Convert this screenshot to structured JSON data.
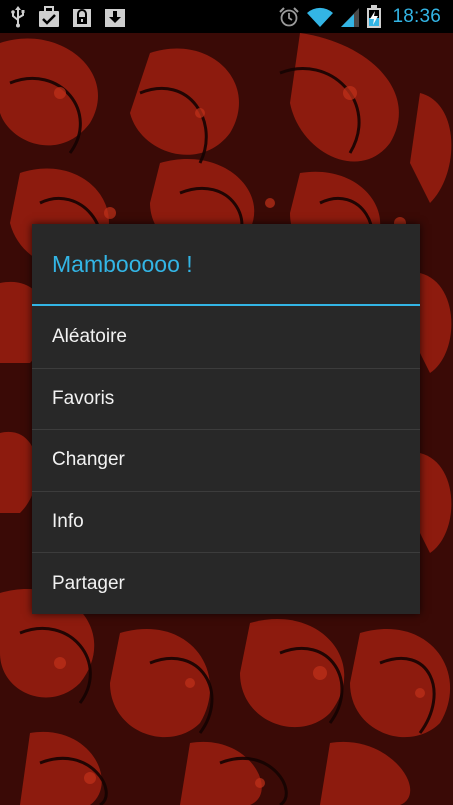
{
  "status_bar": {
    "time": "18:36",
    "left_icons": [
      "usb-icon",
      "checkbox-icon",
      "lock-icon",
      "download-icon"
    ],
    "right_icons": [
      "alarm-icon",
      "wifi-icon",
      "signal-icon",
      "battery-charging-icon"
    ],
    "accent_color": "#33b5e5"
  },
  "dialog": {
    "title": "Mambooooo !",
    "items": [
      {
        "label": "Aléatoire"
      },
      {
        "label": "Favoris"
      },
      {
        "label": "Changer"
      },
      {
        "label": "Info"
      },
      {
        "label": "Partager"
      }
    ]
  },
  "colors": {
    "accent": "#33b5e5",
    "dialog_bg": "#282828",
    "wallpaper_base": "#3a0a06",
    "wallpaper_red": "#a8200f"
  }
}
